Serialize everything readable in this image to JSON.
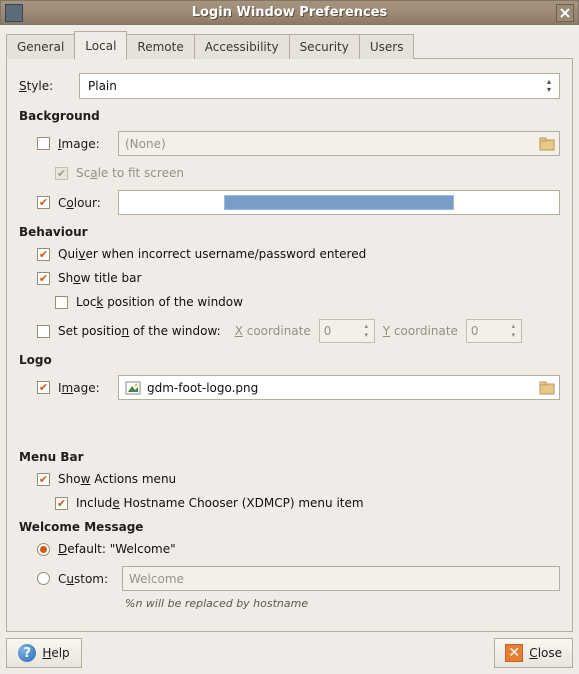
{
  "window": {
    "title": "Login Window Preferences",
    "close_tooltip": "Close"
  },
  "tabs": {
    "general": "General",
    "local": "Local",
    "remote": "Remote",
    "accessibility": "Accessibility",
    "security": "Security",
    "users": "Users"
  },
  "style": {
    "label": "Style:",
    "value": "Plain"
  },
  "background": {
    "title": "Background",
    "image_label": "Image:",
    "image_placeholder": "(None)",
    "scale_label": "Scale to fit screen",
    "colour_label": "Colour:",
    "colour_value": "#779dc8"
  },
  "behaviour": {
    "title": "Behaviour",
    "quiver": "Quiver when incorrect username/password entered",
    "titlebar": "Show title bar",
    "lock": "Lock position of the window",
    "setpos": "Set position of the window:",
    "x_label": "X coordinate",
    "x_value": "0",
    "y_label": "Y coordinate",
    "y_value": "0"
  },
  "logo": {
    "title": "Logo",
    "image_label": "Image:",
    "image_value": "gdm-foot-logo.png"
  },
  "menubar": {
    "title": "Menu Bar",
    "actions": "Show Actions menu",
    "xdmcp": "Include Hostname Chooser (XDMCP) menu item"
  },
  "welcome": {
    "title": "Welcome Message",
    "default_label": "Default: \"Welcome\"",
    "custom_label": "Custom:",
    "custom_placeholder": "Welcome",
    "footnote": "%n will be replaced by hostname"
  },
  "buttons": {
    "help": "Help",
    "close": "Close"
  }
}
